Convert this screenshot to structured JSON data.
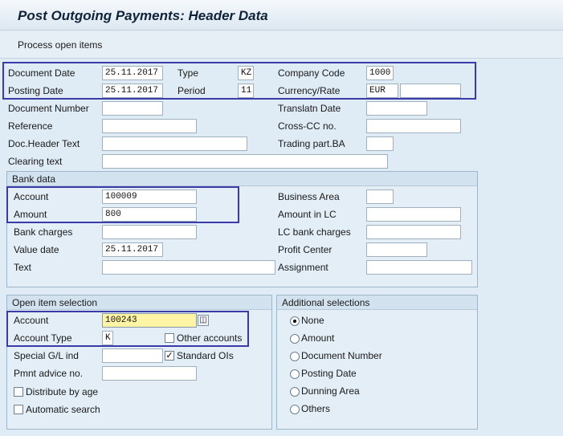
{
  "window": {
    "title": "Post Outgoing Payments: Header Data"
  },
  "toolbar": {
    "process_open_items": "Process open items"
  },
  "header": {
    "document_date_label": "Document Date",
    "document_date": "25.11.2017",
    "type_label": "Type",
    "type": "KZ",
    "company_code_label": "Company Code",
    "company_code": "1000",
    "posting_date_label": "Posting Date",
    "posting_date": "25.11.2017",
    "period_label": "Period",
    "period": "11",
    "currency_rate_label": "Currency/Rate",
    "currency": "EUR",
    "rate": "",
    "document_number_label": "Document Number",
    "document_number": "",
    "translatn_date_label": "Translatn Date",
    "translatn_date": "",
    "reference_label": "Reference",
    "reference": "",
    "cross_cc_label": "Cross-CC no.",
    "cross_cc": "",
    "doc_header_text_label": "Doc.Header Text",
    "doc_header_text": "",
    "trading_part_label": "Trading part.BA",
    "trading_part": "",
    "clearing_text_label": "Clearing text",
    "clearing_text": ""
  },
  "bank_data": {
    "title": "Bank data",
    "account_label": "Account",
    "account": "100009",
    "amount_label": "Amount",
    "amount": "800",
    "bank_charges_label": "Bank charges",
    "bank_charges": "",
    "value_date_label": "Value date",
    "value_date": "25.11.2017",
    "text_label": "Text",
    "text": "",
    "business_area_label": "Business Area",
    "business_area": "",
    "amount_lc_label": "Amount in LC",
    "amount_lc": "",
    "lc_bank_charges_label": "LC bank charges",
    "lc_bank_charges": "",
    "profit_center_label": "Profit Center",
    "profit_center": "",
    "assignment_label": "Assignment",
    "assignment": ""
  },
  "open_item_selection": {
    "title": "Open item selection",
    "account_label": "Account",
    "account": "100243",
    "account_type_label": "Account Type",
    "account_type": "K",
    "other_accounts_label": "Other accounts",
    "other_accounts_checked": false,
    "special_gl_label": "Special G/L ind",
    "special_gl": "",
    "standard_ois_label": "Standard OIs",
    "standard_ois_checked": true,
    "pmnt_advice_label": "Pmnt advice no.",
    "pmnt_advice": "",
    "distribute_by_age_label": "Distribute by age",
    "distribute_by_age_checked": false,
    "automatic_search_label": "Automatic search",
    "automatic_search_checked": false
  },
  "additional_selections": {
    "title": "Additional selections",
    "options": [
      {
        "label": "None",
        "selected": true
      },
      {
        "label": "Amount",
        "selected": false
      },
      {
        "label": "Document Number",
        "selected": false
      },
      {
        "label": "Posting Date",
        "selected": false
      },
      {
        "label": "Dunning Area",
        "selected": false
      },
      {
        "label": "Others",
        "selected": false
      }
    ]
  },
  "colors": {
    "highlight_frame": "#3a3aa8",
    "focused_field": "#fff5a5"
  }
}
